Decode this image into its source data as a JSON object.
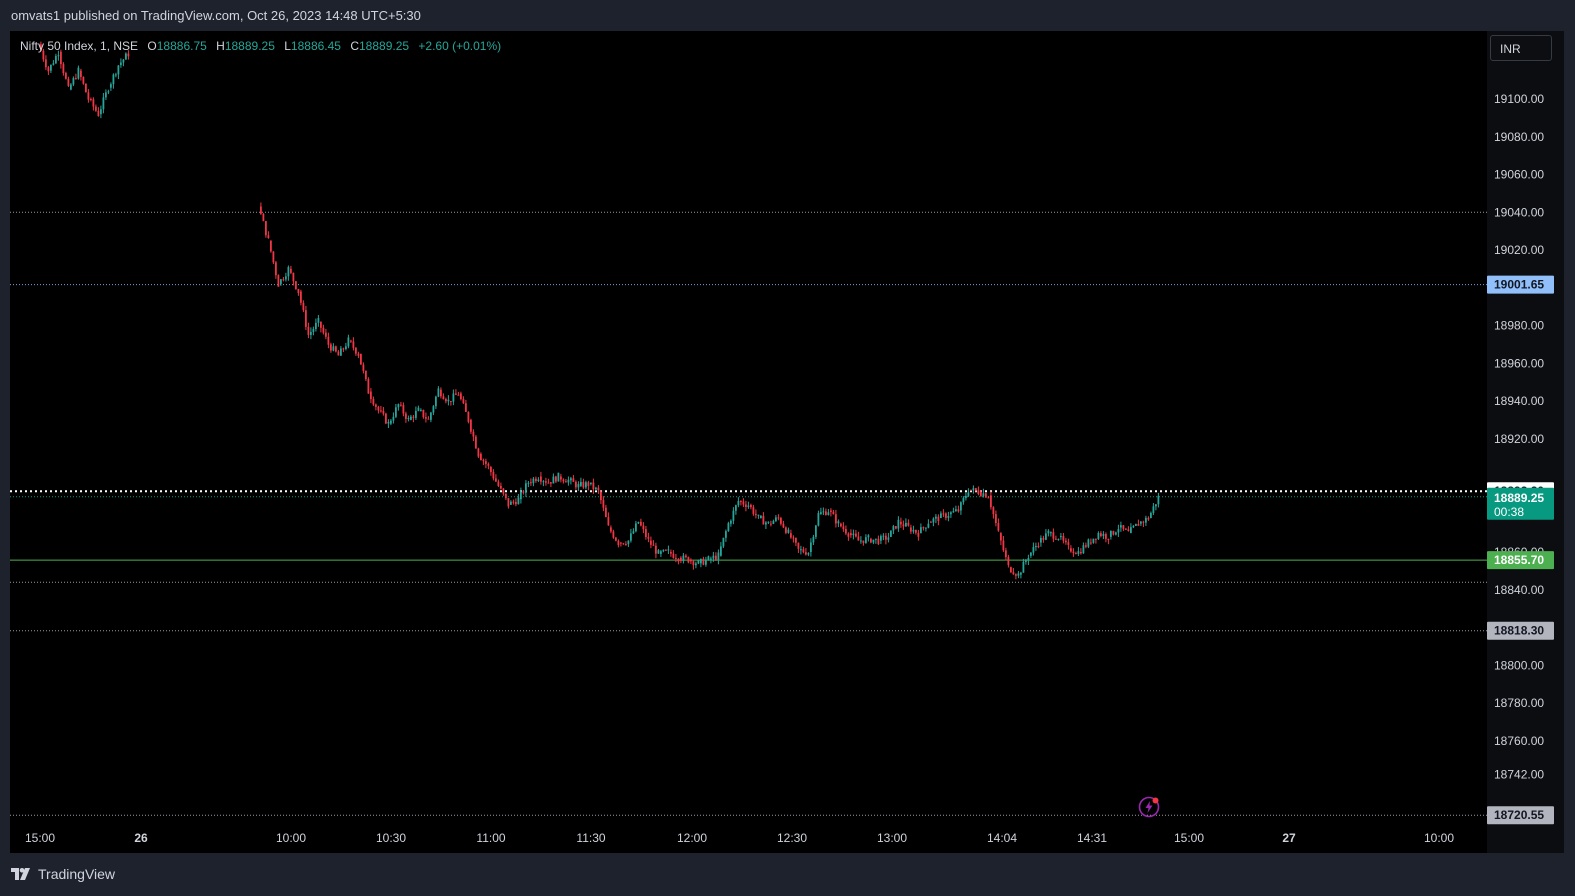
{
  "header": {
    "publish_text": "omvats1 published on TradingView.com, Oct 26, 2023 14:48 UTC+5:30"
  },
  "legend": {
    "symbol": "Nifty 50 Index, 1, NSE",
    "open_label": "O",
    "open": "18886.75",
    "high_label": "H",
    "high": "18889.25",
    "low_label": "L",
    "low": "18886.45",
    "close_label": "C",
    "close": "18889.25",
    "change": "+2.60 (+0.01%)"
  },
  "currency_button": "INR",
  "footer": {
    "brand": "TradingView"
  },
  "icons": {
    "logo": "tradingview-logo-icon",
    "flash": "lightning-icon"
  },
  "colors": {
    "up": "#26a69a",
    "down": "#f23645",
    "bg": "#000000",
    "axis_bg": "#0c0d11",
    "level_green": "#4caf50",
    "level_blue": "#90bff9",
    "level_gray": "#b2b5be",
    "current": "#089981"
  },
  "chart_data": {
    "type": "candlestick",
    "title": "Nifty 50 Index, 1, NSE",
    "y_axis": {
      "range": [
        18712,
        19130
      ],
      "ticks": [
        19100,
        19080,
        19060,
        19040,
        19020,
        18980,
        18960,
        18940,
        18920,
        18860,
        18840,
        18800,
        18780,
        18760,
        18742
      ],
      "tick_labels": [
        "19100.00",
        "19080.00",
        "19060.00",
        "19040.00",
        "19020.00",
        "18980.00",
        "18960.00",
        "18940.00",
        "18920.00",
        "18860.00",
        "18840.00",
        "18800.00",
        "18780.00",
        "18760.00",
        "18742.00"
      ]
    },
    "x_axis": {
      "ticks": [
        {
          "label": "15:00",
          "bold": false
        },
        {
          "label": "26",
          "bold": true
        },
        {
          "label": "10:00",
          "bold": false
        },
        {
          "label": "10:30",
          "bold": false
        },
        {
          "label": "11:00",
          "bold": false
        },
        {
          "label": "11:30",
          "bold": false
        },
        {
          "label": "12:00",
          "bold": false
        },
        {
          "label": "12:30",
          "bold": false
        },
        {
          "label": "13:00",
          "bold": false
        },
        {
          "label": "14:04",
          "bold": false
        },
        {
          "label": "14:31",
          "bold": false
        },
        {
          "label": "15:00",
          "bold": false
        },
        {
          "label": "27",
          "bold": true
        },
        {
          "label": "10:00",
          "bold": false
        }
      ]
    },
    "levels": [
      {
        "price": 19040,
        "style": "dotted",
        "color": "#b2b5be",
        "label": ""
      },
      {
        "price": 19001.65,
        "style": "dotted",
        "color": "#90bff9",
        "label": "19001.65"
      },
      {
        "price": 18892.2,
        "style": "dotted-thick",
        "color": "#ffffff",
        "label": "18892.20"
      },
      {
        "price": 18855.7,
        "style": "solid",
        "color": "#4caf50",
        "label": "18855.70"
      },
      {
        "price": 18844,
        "style": "dotted",
        "color": "#b2b5be",
        "label": ""
      },
      {
        "price": 18818.3,
        "style": "dotted",
        "color": "#b2b5be",
        "label": "18818.30"
      },
      {
        "price": 18720.55,
        "style": "dotted",
        "color": "#b2b5be",
        "label": "18720.55"
      }
    ],
    "current_price": {
      "price": 18889.25,
      "label": "18889.25",
      "countdown": "00:38"
    },
    "price_path": [
      [
        0,
        19129
      ],
      [
        1,
        19115
      ],
      [
        2,
        19125
      ],
      [
        3,
        19105
      ],
      [
        4,
        19115
      ],
      [
        5,
        19100
      ],
      [
        6,
        19092
      ],
      [
        7,
        19106
      ],
      [
        8,
        19118
      ],
      [
        9,
        19124
      ],
      [
        22,
        19043
      ],
      [
        23,
        19025
      ],
      [
        24,
        19002
      ],
      [
        25,
        19010
      ],
      [
        26,
        18998
      ],
      [
        27,
        18975
      ],
      [
        28,
        18982
      ],
      [
        29,
        18970
      ],
      [
        30,
        18964
      ],
      [
        31,
        18972
      ],
      [
        32,
        18965
      ],
      [
        33,
        18945
      ],
      [
        34,
        18935
      ],
      [
        35,
        18928
      ],
      [
        36,
        18938
      ],
      [
        37,
        18930
      ],
      [
        38,
        18935
      ],
      [
        39,
        18930
      ],
      [
        40,
        18946
      ],
      [
        41,
        18940
      ],
      [
        42,
        18944
      ],
      [
        43,
        18930
      ],
      [
        44,
        18912
      ],
      [
        45,
        18905
      ],
      [
        46,
        18895
      ],
      [
        47,
        18885
      ],
      [
        48,
        18888
      ],
      [
        49,
        18897
      ],
      [
        50,
        18900
      ],
      [
        51,
        18897
      ],
      [
        52,
        18900
      ],
      [
        53,
        18898
      ],
      [
        54,
        18895
      ],
      [
        55,
        18896
      ],
      [
        56,
        18892
      ],
      [
        57,
        18873
      ],
      [
        58,
        18865
      ],
      [
        59,
        18866
      ],
      [
        60,
        18876
      ],
      [
        61,
        18866
      ],
      [
        62,
        18859
      ],
      [
        63,
        18860
      ],
      [
        64,
        18857
      ],
      [
        65,
        18856
      ],
      [
        66,
        18854
      ],
      [
        67,
        18856
      ],
      [
        68,
        18858
      ],
      [
        69,
        18875
      ],
      [
        70,
        18887
      ],
      [
        71,
        18885
      ],
      [
        72,
        18878
      ],
      [
        73,
        18875
      ],
      [
        74,
        18878
      ],
      [
        75,
        18870
      ],
      [
        76,
        18861
      ],
      [
        77,
        18860
      ],
      [
        78,
        18880
      ],
      [
        79,
        18882
      ],
      [
        80,
        18875
      ],
      [
        81,
        18870
      ],
      [
        82,
        18866
      ],
      [
        83,
        18867
      ],
      [
        84,
        18866
      ],
      [
        85,
        18868
      ],
      [
        86,
        18876
      ],
      [
        87,
        18873
      ],
      [
        88,
        18870
      ],
      [
        89,
        18876
      ],
      [
        90,
        18878
      ],
      [
        91,
        18880
      ],
      [
        92,
        18882
      ],
      [
        93,
        18893
      ],
      [
        94,
        18892
      ],
      [
        95,
        18890
      ],
      [
        96,
        18870
      ],
      [
        97,
        18852
      ],
      [
        98,
        18848
      ],
      [
        99,
        18858
      ],
      [
        100,
        18865
      ],
      [
        101,
        18870
      ],
      [
        102,
        18868
      ],
      [
        103,
        18862
      ],
      [
        104,
        18860
      ],
      [
        105,
        18865
      ],
      [
        106,
        18870
      ],
      [
        107,
        18868
      ],
      [
        108,
        18873
      ],
      [
        109,
        18870
      ],
      [
        110,
        18875
      ],
      [
        111,
        18878
      ],
      [
        112,
        18889
      ]
    ]
  }
}
